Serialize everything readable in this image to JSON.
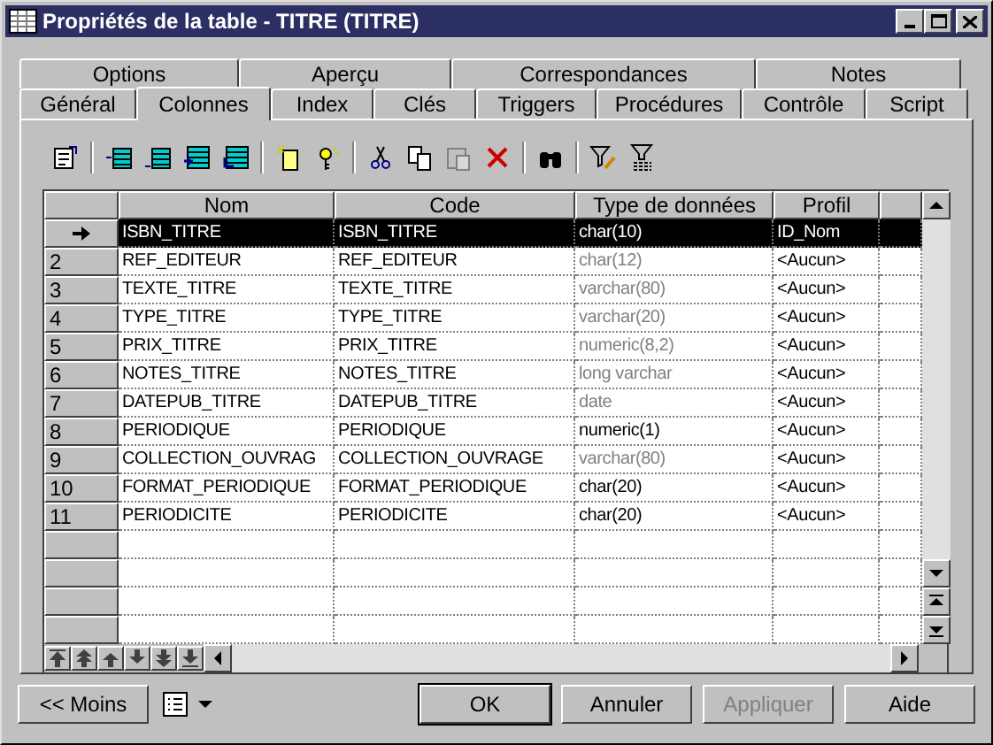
{
  "window": {
    "title": "Propriétés de la table - TITRE (TITRE)"
  },
  "tab_rows": [
    [
      {
        "label": "Options",
        "selected": false
      },
      {
        "label": "Aperçu",
        "selected": false
      },
      {
        "label": "Correspondances",
        "selected": false
      },
      {
        "label": "Notes",
        "selected": false
      }
    ],
    [
      {
        "label": "Général",
        "selected": false
      },
      {
        "label": "Colonnes",
        "selected": true
      },
      {
        "label": "Index",
        "selected": false
      },
      {
        "label": "Clés",
        "selected": false
      },
      {
        "label": "Triggers",
        "selected": false
      },
      {
        "label": "Procédures",
        "selected": false
      },
      {
        "label": "Contrôle",
        "selected": false
      },
      {
        "label": "Script",
        "selected": false
      }
    ]
  ],
  "toolbar": [
    {
      "kind": "properties",
      "disabled": false
    },
    {
      "kind": "sep"
    },
    {
      "kind": "insert",
      "disabled": false
    },
    {
      "kind": "add",
      "disabled": false
    },
    {
      "kind": "addlist",
      "disabled": false
    },
    {
      "kind": "reuse",
      "disabled": false
    },
    {
      "kind": "sep"
    },
    {
      "kind": "newdoc",
      "disabled": false
    },
    {
      "kind": "key",
      "disabled": false
    },
    {
      "kind": "sep"
    },
    {
      "kind": "cut",
      "disabled": false
    },
    {
      "kind": "copy",
      "disabled": false
    },
    {
      "kind": "paste",
      "disabled": true
    },
    {
      "kind": "delete",
      "disabled": false
    },
    {
      "kind": "sep"
    },
    {
      "kind": "find",
      "disabled": false
    },
    {
      "kind": "sep"
    },
    {
      "kind": "filter",
      "disabled": false
    },
    {
      "kind": "nofilter",
      "disabled": false
    }
  ],
  "table": {
    "columns": [
      "Nom",
      "Code",
      "Type de données",
      "Profil"
    ],
    "rows": [
      {
        "selected": true,
        "nom": "ISBN_TITRE",
        "code": "ISBN_TITRE",
        "type": "char(10)",
        "inherited": false,
        "profil": "ID_Nom"
      },
      {
        "selected": false,
        "number": "2",
        "nom": "REF_EDITEUR",
        "code": "REF_EDITEUR",
        "type": "char(12)",
        "inherited": true,
        "profil": "<Aucun>"
      },
      {
        "selected": false,
        "number": "3",
        "nom": "TEXTE_TITRE",
        "code": "TEXTE_TITRE",
        "type": "varchar(80)",
        "inherited": true,
        "profil": "<Aucun>"
      },
      {
        "selected": false,
        "number": "4",
        "nom": "TYPE_TITRE",
        "code": "TYPE_TITRE",
        "type": "varchar(20)",
        "inherited": true,
        "profil": "<Aucun>"
      },
      {
        "selected": false,
        "number": "5",
        "nom": "PRIX_TITRE",
        "code": "PRIX_TITRE",
        "type": "numeric(8,2)",
        "inherited": true,
        "profil": "<Aucun>"
      },
      {
        "selected": false,
        "number": "6",
        "nom": "NOTES_TITRE",
        "code": "NOTES_TITRE",
        "type": "long varchar",
        "inherited": true,
        "profil": "<Aucun>"
      },
      {
        "selected": false,
        "number": "7",
        "nom": "DATEPUB_TITRE",
        "code": "DATEPUB_TITRE",
        "type": "date",
        "inherited": true,
        "profil": "<Aucun>"
      },
      {
        "selected": false,
        "number": "8",
        "nom": "PERIODIQUE",
        "code": "PERIODIQUE",
        "type": "numeric(1)",
        "inherited": false,
        "profil": "<Aucun>"
      },
      {
        "selected": false,
        "number": "9",
        "nom": "COLLECTION_OUVRAG",
        "code": "COLLECTION_OUVRAGE",
        "type": "varchar(80)",
        "inherited": true,
        "profil": "<Aucun>"
      },
      {
        "selected": false,
        "number": "10",
        "nom": "FORMAT_PERIODIQUE",
        "code": "FORMAT_PERIODIQUE",
        "type": "char(20)",
        "inherited": false,
        "profil": "<Aucun>"
      },
      {
        "selected": false,
        "number": "11",
        "nom": "PERIODICITE",
        "code": "PERIODICITE",
        "type": "char(20)",
        "inherited": false,
        "profil": "<Aucun>"
      }
    ]
  },
  "footer": {
    "less_button": "<< Moins",
    "buttons": [
      {
        "label": "OK",
        "kind": "default",
        "disabled": false
      },
      {
        "label": "Annuler",
        "kind": "normal",
        "disabled": false
      },
      {
        "label": "Appliquer",
        "kind": "normal",
        "disabled": true
      },
      {
        "label": "Aide",
        "kind": "normal",
        "disabled": false
      }
    ]
  }
}
